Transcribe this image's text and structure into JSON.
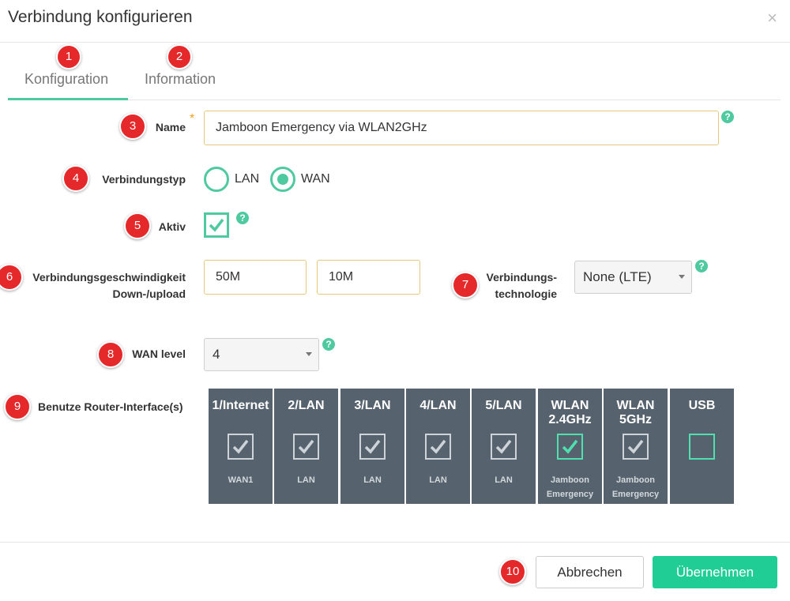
{
  "dialog": {
    "title": "Verbindung konfigurieren",
    "close_symbol": "×"
  },
  "tabs": [
    {
      "label": "Konfiguration",
      "active": true
    },
    {
      "label": "Information",
      "active": false
    }
  ],
  "badges": [
    "1",
    "2",
    "3",
    "4",
    "5",
    "6",
    "7",
    "8",
    "9",
    "10"
  ],
  "form": {
    "name_label": "Name",
    "name_value": "Jamboon Emergency via WLAN2GHz",
    "required_mark": "*",
    "help_symbol": "?",
    "connection_type_label": "Verbindungstyp",
    "connection_type_options": [
      "LAN",
      "WAN"
    ],
    "connection_type_selected": "WAN",
    "active_label": "Aktiv",
    "active_checked": true,
    "speed_label_line1": "Verbindungsgeschwindigkeit",
    "speed_label_line2": "Down-/upload",
    "speed_down": "50M",
    "speed_up": "10M",
    "technology_label_line1": "Verbindungs-",
    "technology_label_line2": "technologie",
    "technology_value": "None (LTE)",
    "wan_level_label": "WAN level",
    "wan_level_value": "4",
    "interfaces_label": "Benutze Router-Interface(s)"
  },
  "interfaces": [
    {
      "name": "1/Internet",
      "checked": true,
      "highlight": false,
      "sub": "WAN1"
    },
    {
      "name": "2/LAN",
      "checked": true,
      "highlight": false,
      "sub": "LAN"
    },
    {
      "name": "3/LAN",
      "checked": true,
      "highlight": false,
      "sub": "LAN"
    },
    {
      "name": "4/LAN",
      "checked": true,
      "highlight": false,
      "sub": "LAN"
    },
    {
      "name": "5/LAN",
      "checked": true,
      "highlight": false,
      "sub": "LAN"
    },
    {
      "name": "WLAN\n2.4GHz",
      "checked": true,
      "highlight": true,
      "sub": "Jamboon\nEmergency"
    },
    {
      "name": "WLAN\n5GHz",
      "checked": true,
      "highlight": false,
      "sub": "Jamboon\nEmergency"
    },
    {
      "name": "USB",
      "checked": false,
      "highlight": true,
      "sub": ""
    }
  ],
  "footer": {
    "cancel_label": "Abbrechen",
    "ok_label": "Übernehmen"
  },
  "colors": {
    "accent": "#4fcaa0",
    "badge": "#e5282a",
    "tile": "#56636e",
    "primary_button": "#1fcd95"
  }
}
